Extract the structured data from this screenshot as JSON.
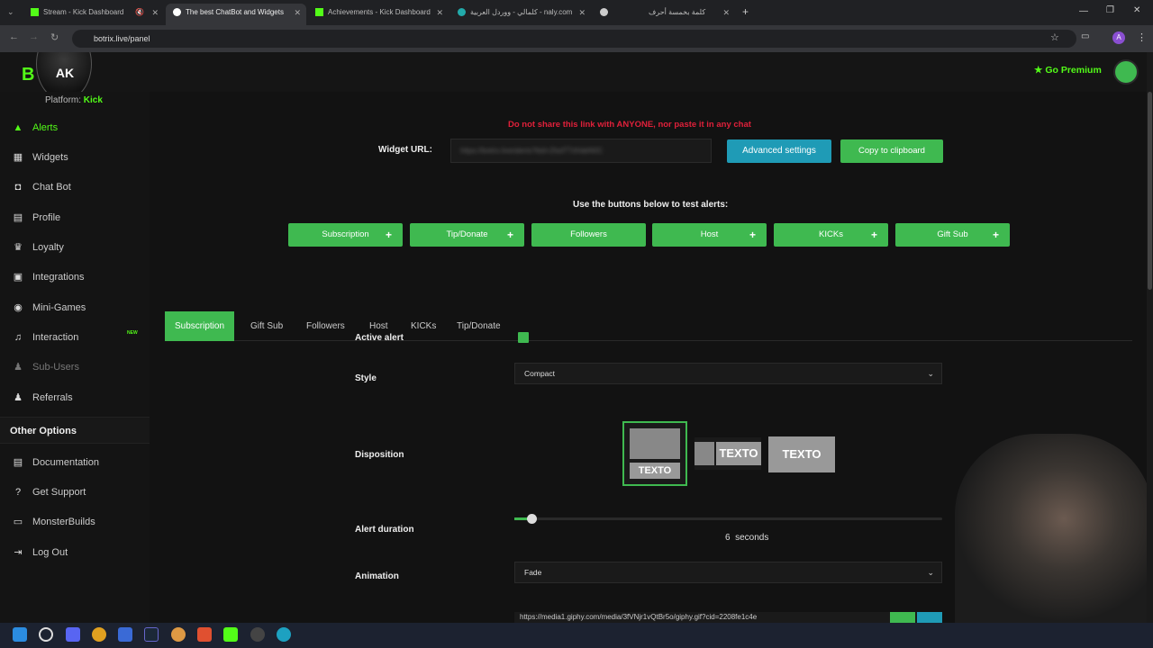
{
  "browser": {
    "tabs": [
      {
        "title": "Stream - Kick Dashboard",
        "icon": "kick-icon"
      },
      {
        "title": "The best ChatBot and Widgets",
        "icon": "botrix-icon"
      },
      {
        "title": "Achievements - Kick Dashboard",
        "icon": "kick-icon"
      },
      {
        "title": "كلمالي - ووردل العربية - naly.com",
        "icon": "globe-icon"
      },
      {
        "title": "",
        "icon": "globe-icon"
      },
      {
        "title": "كلمة بخمسة أحرف",
        "icon": "globe-icon"
      }
    ],
    "new_tab": "+",
    "url": "botrix.live/panel",
    "profile_initial": "A"
  },
  "topbar": {
    "go_premium": "Go Premium"
  },
  "sidebar": {
    "platform_label": "Platform:",
    "platform_value": "Kick",
    "items": [
      {
        "label": "Alerts",
        "icon": "bell-icon"
      },
      {
        "label": "Widgets",
        "icon": "grid-icon"
      },
      {
        "label": "Chat Bot",
        "icon": "robot-icon"
      },
      {
        "label": "Profile",
        "icon": "profile-card-icon"
      },
      {
        "label": "Loyalty",
        "icon": "trophy-icon"
      },
      {
        "label": "Integrations",
        "icon": "plug-icon"
      },
      {
        "label": "Mini-Games",
        "icon": "gamepad-icon"
      },
      {
        "label": "Interaction",
        "icon": "music-icon"
      },
      {
        "label": "Sub-Users",
        "icon": "users-icon"
      },
      {
        "label": "Referrals",
        "icon": "referral-icon"
      }
    ],
    "new_badge": "NEW",
    "other_options_title": "Other Options",
    "other_items": [
      {
        "label": "Documentation",
        "icon": "document-icon"
      },
      {
        "label": "Get Support",
        "icon": "help-icon"
      },
      {
        "label": "MonsterBuilds",
        "icon": "desktop-icon"
      },
      {
        "label": "Log Out",
        "icon": "logout-icon"
      }
    ]
  },
  "main": {
    "warning": "Do not share this link with ANYONE, nor paste it in any chat",
    "widget_url_label": "Widget URL:",
    "widget_url_value": "https://botrix.live/alerts?bid=ZlsdTTdVabN0C",
    "advanced_settings": "Advanced settings",
    "copy_clipboard": "Copy to clipboard",
    "test_heading": "Use the buttons below to test alerts:",
    "test_buttons": [
      "Subscription",
      "Tip/Donate",
      "Followers",
      "Host",
      "KICKs",
      "Gift Sub"
    ],
    "tabs": [
      "Subscription",
      "Gift Sub",
      "Followers",
      "Host",
      "KICKs",
      "Tip/Donate"
    ],
    "active_alert_label": "Active alert",
    "active_alert_checked": true,
    "style_label": "Style",
    "style_value": "Compact",
    "disposition_label": "Disposition",
    "disposition_text": "TEXTO",
    "alert_duration_label": "Alert duration",
    "alert_duration_value": "6",
    "alert_duration_unit": "seconds",
    "alert_duration_fraction": 0.04,
    "animation_label": "Animation",
    "animation_value": "Fade",
    "image_url_value": "https://media1.giphy.com/media/3fVNjr1vQtBr5o/giphy.gif?cid=2208fe1c4e"
  },
  "colors": {
    "kick_green": "#53fc18",
    "button_green": "#3fb950",
    "button_blue": "#1f9bb6",
    "warning_red": "#e0203a"
  }
}
